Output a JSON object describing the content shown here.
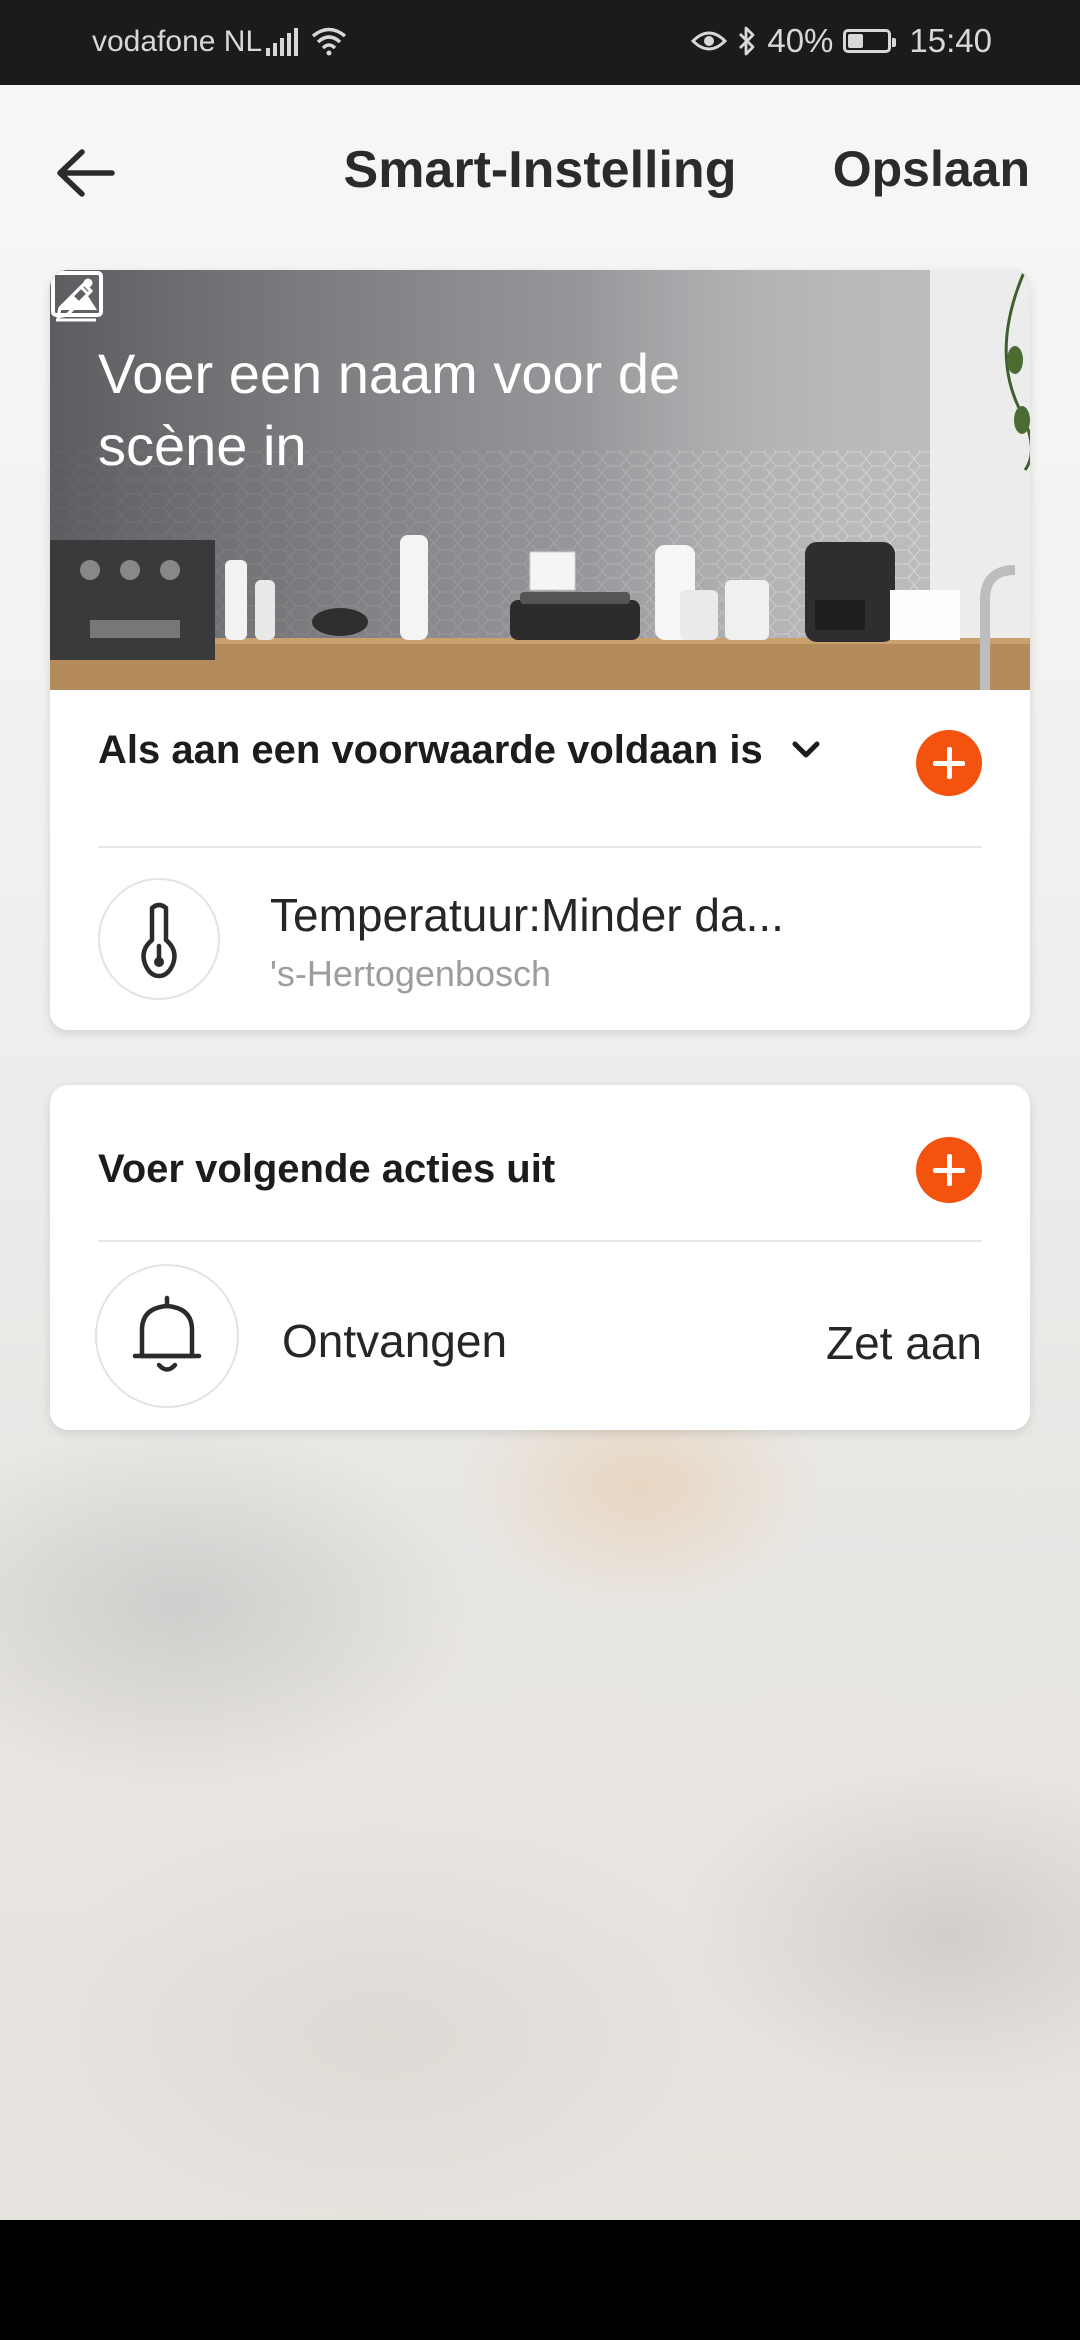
{
  "status_bar": {
    "carrier": "vodafone NL",
    "battery_percent": "40%",
    "battery_level": 0.4,
    "time": "15:40",
    "icons": [
      "signal-icon",
      "wifi-icon",
      "eye-icon",
      "bluetooth-icon",
      "battery-icon"
    ]
  },
  "header": {
    "title": "Smart-Instelling",
    "save_label": "Opslaan",
    "back_icon": "arrow-left-icon"
  },
  "scene": {
    "name_placeholder": "Voer een naam voor de scène in",
    "edit_icon": "pencil-icon",
    "image_icon": "image-icon"
  },
  "conditions": {
    "header_label": "Als aan een voorwaarde voldaan is",
    "items": [
      {
        "title": "Temperatuur:Minder da...",
        "subtitle": "'s-Hertogenbosch",
        "icon": "thermometer-icon"
      }
    ]
  },
  "actions": {
    "header_label": "Voer volgende acties uit",
    "items": [
      {
        "title": "Ontvangen",
        "value": "Zet aan",
        "icon": "bell-icon"
      }
    ]
  },
  "colors": {
    "accent": "#F3520F",
    "text_primary": "#262626",
    "text_secondary": "#9D9D9D"
  }
}
